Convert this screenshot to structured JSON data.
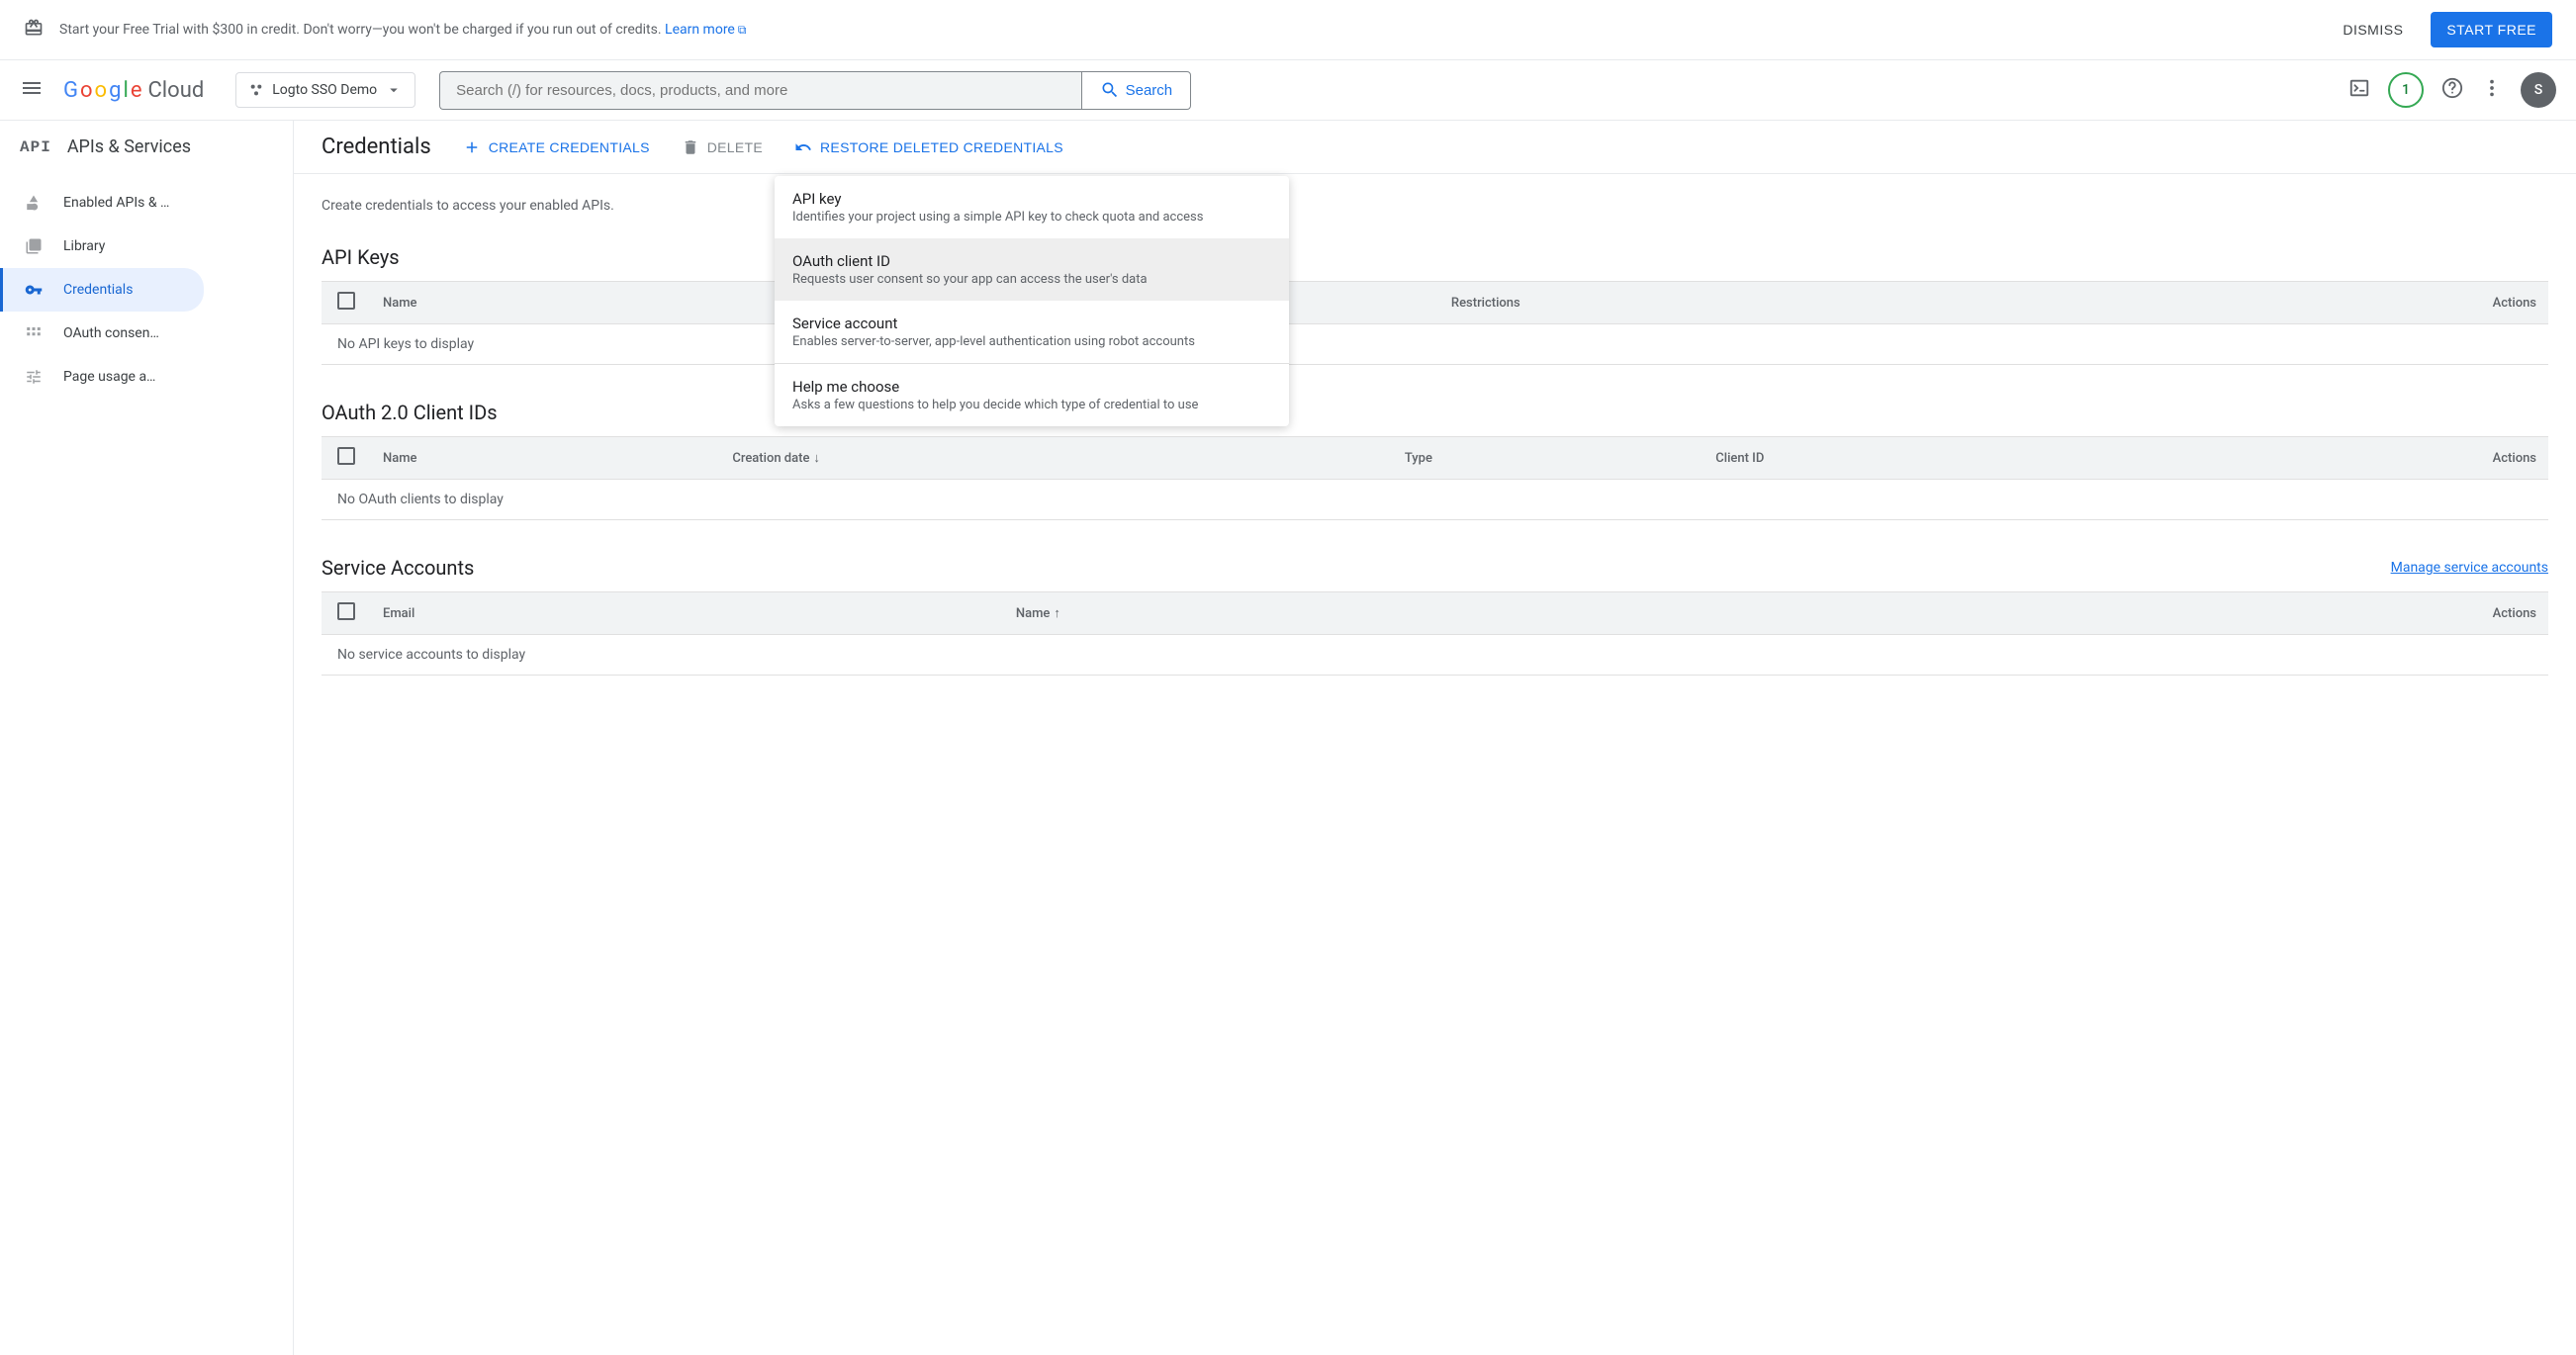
{
  "banner": {
    "text": "Start your Free Trial with $300 in credit. Don't worry—you won't be charged if you run out of credits. ",
    "learn_more": "Learn more",
    "dismiss": "DISMISS",
    "start_free": "START FREE"
  },
  "header": {
    "logo_text": "Google Cloud",
    "project_name": "Logto SSO Demo",
    "search_placeholder": "Search (/) for resources, docs, products, and more",
    "search_button": "Search",
    "trial_days": "1",
    "avatar_initial": "S"
  },
  "sidebar": {
    "section_title": "APIs & Services",
    "items": [
      {
        "label": "Enabled APIs & …"
      },
      {
        "label": "Library"
      },
      {
        "label": "Credentials"
      },
      {
        "label": "OAuth consen…"
      },
      {
        "label": "Page usage a…"
      }
    ]
  },
  "content": {
    "page_title": "Credentials",
    "create_credentials": "CREATE CREDENTIALS",
    "delete": "DELETE",
    "restore": "RESTORE DELETED CREDENTIALS",
    "description": "Create credentials to access your enabled APIs.",
    "sections": {
      "api_keys": {
        "title": "API Keys",
        "columns": {
          "name": "Name",
          "restrictions": "Restrictions",
          "actions": "Actions"
        },
        "empty_message": "No API keys to display"
      },
      "oauth_clients": {
        "title": "OAuth 2.0 Client IDs",
        "columns": {
          "name": "Name",
          "creation_date": "Creation date",
          "type": "Type",
          "client_id": "Client ID",
          "actions": "Actions"
        },
        "empty_message": "No OAuth clients to display"
      },
      "service_accounts": {
        "title": "Service Accounts",
        "manage_link": "Manage service accounts",
        "columns": {
          "email": "Email",
          "name": "Name",
          "actions": "Actions"
        },
        "empty_message": "No service accounts to display"
      }
    }
  },
  "dropdown": {
    "items": [
      {
        "title": "API key",
        "desc": "Identifies your project using a simple API key to check quota and access"
      },
      {
        "title": "OAuth client ID",
        "desc": "Requests user consent so your app can access the user's data"
      },
      {
        "title": "Service account",
        "desc": "Enables server-to-server, app-level authentication using robot accounts"
      },
      {
        "title": "Help me choose",
        "desc": "Asks a few questions to help you decide which type of credential to use"
      }
    ]
  }
}
